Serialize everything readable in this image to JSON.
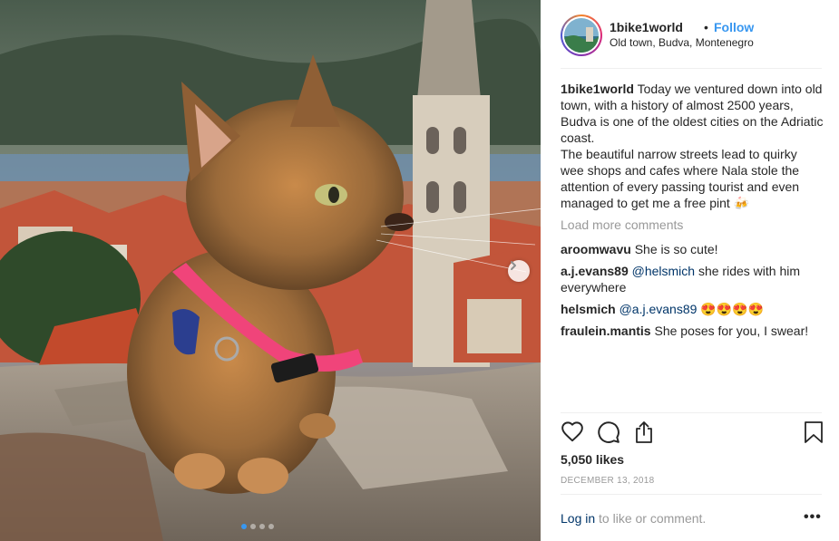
{
  "post": {
    "photo_alt": "Kitten with a pink collar on a stone wall in front of a bell tower",
    "carousel_dots": 4,
    "active_dot": 0
  },
  "header": {
    "username": "1bike1world",
    "separator": "•",
    "follow_label": "Follow",
    "location": "Old town, Budva, Montenegro"
  },
  "caption": {
    "username": "1bike1world",
    "text_1": "Today we ventured down into old town, with a history of almost 2500 years, Budva is one of the oldest cities on the Adriatic coast.",
    "text_2": "The beautiful narrow streets lead to quirky wee shops and cafes where Nala stole the attention of every passing tourist and even managed to get me a free pint 🍻"
  },
  "load_more": "Load more comments",
  "comments": [
    {
      "username": "aroomwavu",
      "mention": "",
      "text": "She is so cute!"
    },
    {
      "username": "a.j.evans89",
      "mention": "@helsmich",
      "text": "she rides with him everywhere"
    },
    {
      "username": "helsmich",
      "mention": "@a.j.evans89",
      "text": "😍😍😍😍"
    },
    {
      "username": "fraulein.mantis",
      "mention": "",
      "text": "She poses for you, I swear!"
    }
  ],
  "likes": "5,050 likes",
  "date": "DECEMBER 13, 2018",
  "login": {
    "link": "Log in",
    "rest": " to like or comment."
  },
  "more_label": "•••",
  "icons": [
    "heart-icon",
    "comment-icon",
    "share-icon",
    "bookmark-icon",
    "chevron-right-icon"
  ]
}
